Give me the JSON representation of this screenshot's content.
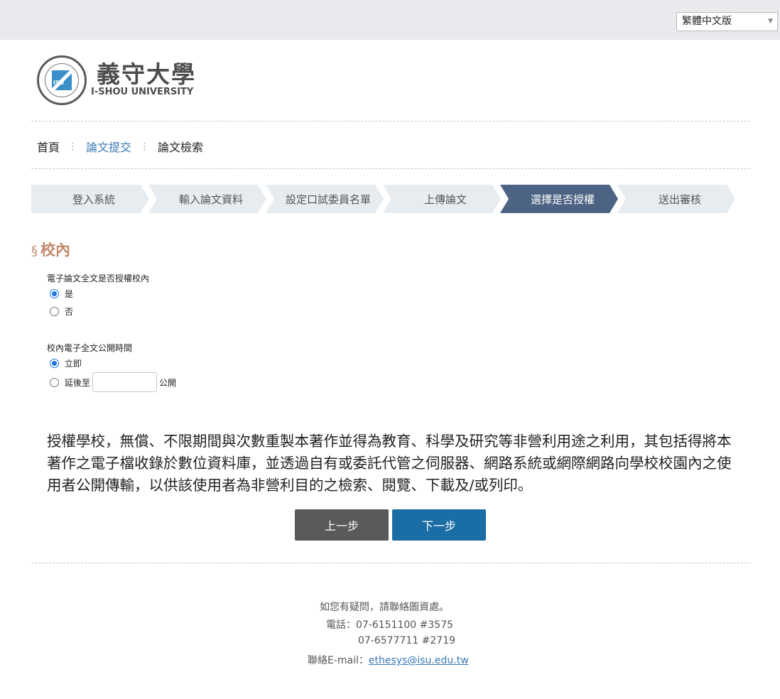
{
  "topbar": {
    "language": "繁體中文版"
  },
  "logo": {
    "cn": "義守大學",
    "en": "I-SHOU UNIVERSITY",
    "emblem": "ISU"
  },
  "nav": [
    {
      "label": "首頁",
      "active": false
    },
    {
      "label": "論文提交",
      "active": true
    },
    {
      "label": "論文檢索",
      "active": false
    }
  ],
  "steps": [
    {
      "label": "登入系統",
      "active": false
    },
    {
      "label": "輸入論文資料",
      "active": false
    },
    {
      "label": "設定口試委員名單",
      "active": false
    },
    {
      "label": "上傳論文",
      "active": false
    },
    {
      "label": "選擇是否授權",
      "active": true
    },
    {
      "label": "送出審核",
      "active": false
    }
  ],
  "section": {
    "mark": "§",
    "title": "校內"
  },
  "authorize": {
    "label": "電子論文全文是否授權校內",
    "options": [
      {
        "label": "是",
        "checked": true
      },
      {
        "label": "否",
        "checked": false
      }
    ]
  },
  "publish_time": {
    "label": "校內電子全文公開時間",
    "immediate": {
      "label": "立即",
      "checked": true
    },
    "delay": {
      "label": "延後至",
      "checked": false,
      "date_value": "",
      "suffix": "公開"
    }
  },
  "notice": "授權學校，無償、不限期間與次數重製本著作並得為教育、科學及研究等非營利用途之利用，其包括得將本著作之電子檔收錄於數位資料庫，並透過自有或委託代管之伺服器、網路系統或網際網路向學校校園內之使用者公開傳輸，以供該使用者為非營利目的之檢索、閱覽、下載及/或列印。",
  "buttons": {
    "prev": "上一步",
    "next": "下一步"
  },
  "footer": {
    "question": "如您有疑問，請聯絡圖資處。",
    "phone_label": "電話：",
    "phone1": "07-6151100 #3575",
    "phone2": "07-6577711 #2719",
    "email_label": "聯絡E-mail：",
    "email": "ethesys@isu.edu.tw"
  }
}
